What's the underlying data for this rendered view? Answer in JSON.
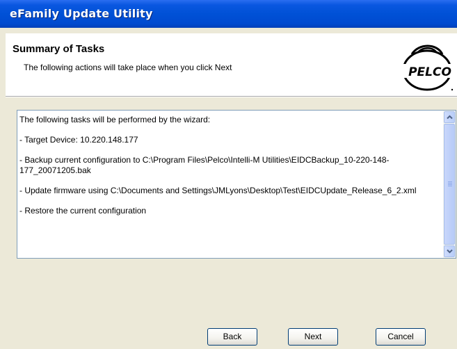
{
  "window": {
    "title": "eFamily Update Utility"
  },
  "header": {
    "title": "Summary of Tasks",
    "subtitle": "The following actions will take place when you click Next",
    "logo_text": "PELCO"
  },
  "tasks": {
    "lines": [
      "The following tasks will be performed by the wizard:",
      "- Target Device: 10.220.148.177",
      "- Backup current configuration to C:\\Program Files\\Pelco\\Intelli-M Utilities\\EIDCBackup_10-220-148-177_20071205.bak",
      "- Update firmware using C:\\Documents and Settings\\JMLyons\\Desktop\\Test\\EIDCUpdate_Release_6_2.xml",
      "- Restore the current configuration"
    ]
  },
  "buttons": {
    "back": "Back",
    "next": "Next",
    "cancel": "Cancel"
  }
}
